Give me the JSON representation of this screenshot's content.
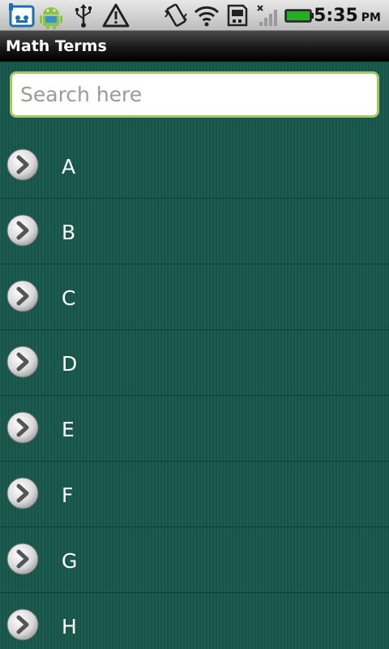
{
  "status_bar": {
    "icons": [
      "bbm-icon",
      "android-icon",
      "usb-icon",
      "warning-icon",
      "vibrate-icon",
      "wifi-icon",
      "sd-card-icon",
      "signal-icon",
      "battery-icon"
    ],
    "time": "5:35",
    "ampm": "PM",
    "battery_color": "#22b020"
  },
  "app": {
    "title": "Math Terms"
  },
  "search": {
    "placeholder": "Search here",
    "value": "",
    "border_color": "#a6c95a"
  },
  "list": {
    "items": [
      {
        "label": "A",
        "icon": "chevron-right-icon"
      },
      {
        "label": "B",
        "icon": "chevron-right-icon"
      },
      {
        "label": "C",
        "icon": "chevron-right-icon"
      },
      {
        "label": "D",
        "icon": "chevron-right-icon"
      },
      {
        "label": "E",
        "icon": "chevron-right-icon"
      },
      {
        "label": "F",
        "icon": "chevron-right-icon"
      },
      {
        "label": "G",
        "icon": "chevron-right-icon"
      },
      {
        "label": "H",
        "icon": "chevron-right-icon"
      }
    ]
  },
  "colors": {
    "background": "#17574c",
    "title_bar": "#111111",
    "status_bar": "#d4d4d4"
  }
}
